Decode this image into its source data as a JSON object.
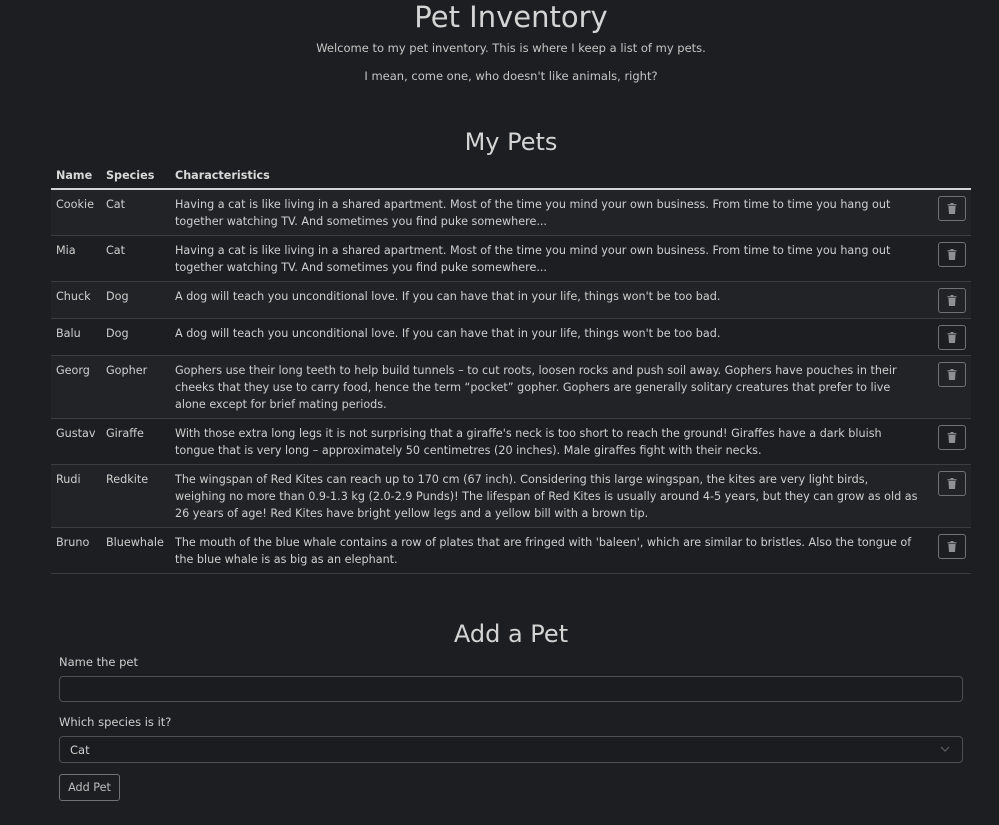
{
  "header": {
    "title": "Pet Inventory",
    "intro_line1": "Welcome to my pet inventory. This is where I keep a list of my pets.",
    "intro_line2": "I mean, come one, who doesn't like animals, right?"
  },
  "pets_section": {
    "heading": "My Pets",
    "columns": [
      "Name",
      "Species",
      "Characteristics"
    ],
    "delete_icon": "trash-icon",
    "rows": [
      {
        "name": "Cookie",
        "species": "Cat",
        "characteristics": "Having a cat is like living in a shared apartment. Most of the time you mind your own business. From time to time you hang out together watching TV. And sometimes you find puke somewhere..."
      },
      {
        "name": "Mia",
        "species": "Cat",
        "characteristics": "Having a cat is like living in a shared apartment. Most of the time you mind your own business. From time to time you hang out together watching TV. And sometimes you find puke somewhere..."
      },
      {
        "name": "Chuck",
        "species": "Dog",
        "characteristics": "A dog will teach you unconditional love. If you can have that in your life, things won't be too bad."
      },
      {
        "name": "Balu",
        "species": "Dog",
        "characteristics": "A dog will teach you unconditional love. If you can have that in your life, things won't be too bad."
      },
      {
        "name": "Georg",
        "species": "Gopher",
        "characteristics": "Gophers use their long teeth to help build tunnels – to cut roots, loosen rocks and push soil away. Gophers have pouches in their cheeks that they use to carry food, hence the term “pocket” gopher. Gophers are generally solitary creatures that prefer to live alone except for brief mating periods."
      },
      {
        "name": "Gustav",
        "species": "Giraffe",
        "characteristics": "With those extra long legs it is not surprising that a giraffe's neck is too short to reach the ground! Giraffes have a dark bluish tongue that is very long – approximately 50 centimetres (20 inches). Male giraffes fight with their necks."
      },
      {
        "name": "Rudi",
        "species": "Redkite",
        "characteristics": "The wingspan of Red Kites can reach up to 170 cm (67 inch). Considering this large wingspan, the kites are very light birds, weighing no more than 0.9-1.3 kg (2.0-2.9 Punds)! The lifespan of Red Kites is usually around 4-5 years, but they can grow as old as 26 years of age! Red Kites have bright yellow legs and a yellow bill with a brown tip."
      },
      {
        "name": "Bruno",
        "species": "Bluewhale",
        "characteristics": "The mouth of the blue whale contains a row of plates that are fringed with 'baleen', which are similar to bristles. Also the tongue of the blue whale is as big as an elephant."
      }
    ]
  },
  "add_section": {
    "heading": "Add a Pet",
    "name_label": "Name the pet",
    "name_value": "",
    "species_label": "Which species is it?",
    "species_selected": "Cat",
    "submit_label": "Add Pet"
  },
  "colors": {
    "background": "#1d1e21",
    "text": "#cfcfcf",
    "row_stripe": "#222326",
    "border": "#3b3d41"
  }
}
